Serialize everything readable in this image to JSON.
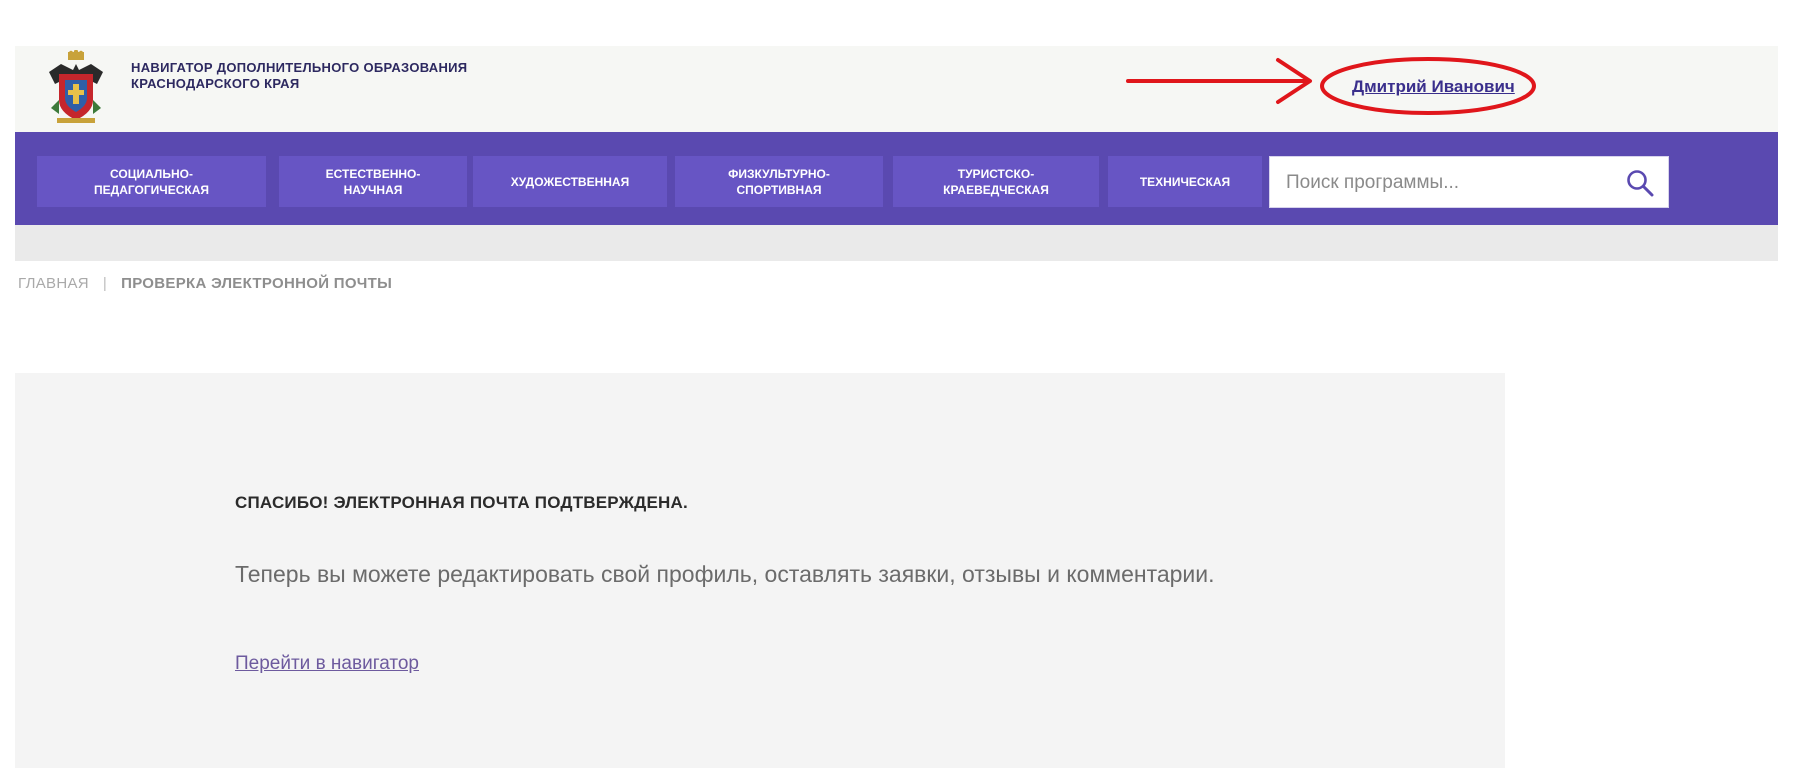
{
  "header": {
    "site_title": "НАВИГАТОР ДОПОЛНИТЕЛЬНОГО ОБРАЗОВАНИЯ КРАСНОДАРСКОГО КРАЯ",
    "logo_icon": "coat-of-arms-icon",
    "user_name": "Дмитрий Иванович"
  },
  "nav": {
    "items": [
      {
        "label": "СОЦИАЛЬНО-\nПЕДАГОГИЧЕСКАЯ"
      },
      {
        "label": "ЕСТЕСТВЕННО-\nНАУЧНАЯ"
      },
      {
        "label": "ХУДОЖЕСТВЕННАЯ"
      },
      {
        "label": "ФИЗКУЛЬТУРНО-\nСПОРТИВНАЯ"
      },
      {
        "label": "ТУРИСТСКО-\nКРАЕВЕДЧЕСКАЯ"
      },
      {
        "label": "ТЕХНИЧЕСКАЯ"
      }
    ],
    "search": {
      "placeholder": "Поиск программы...",
      "value": "",
      "icon": "search-icon"
    }
  },
  "breadcrumb": {
    "home": "ГЛАВНАЯ",
    "separator": "|",
    "current": "ПРОВЕРКА ЭЛЕКТРОННОЙ ПОЧТЫ"
  },
  "message": {
    "title": "СПАСИБО! ЭЛЕКТРОННАЯ ПОЧТА ПОДТВЕРЖДЕНА.",
    "text": "Теперь вы можете редактировать свой профиль, оставлять заявки, отзывы и комментарии.",
    "link": "Перейти в навигатор"
  },
  "colors": {
    "nav_background": "#5a49b0",
    "nav_item": "#6755c4",
    "annotation": "#e0161b",
    "user_link": "#3a2f8c"
  }
}
